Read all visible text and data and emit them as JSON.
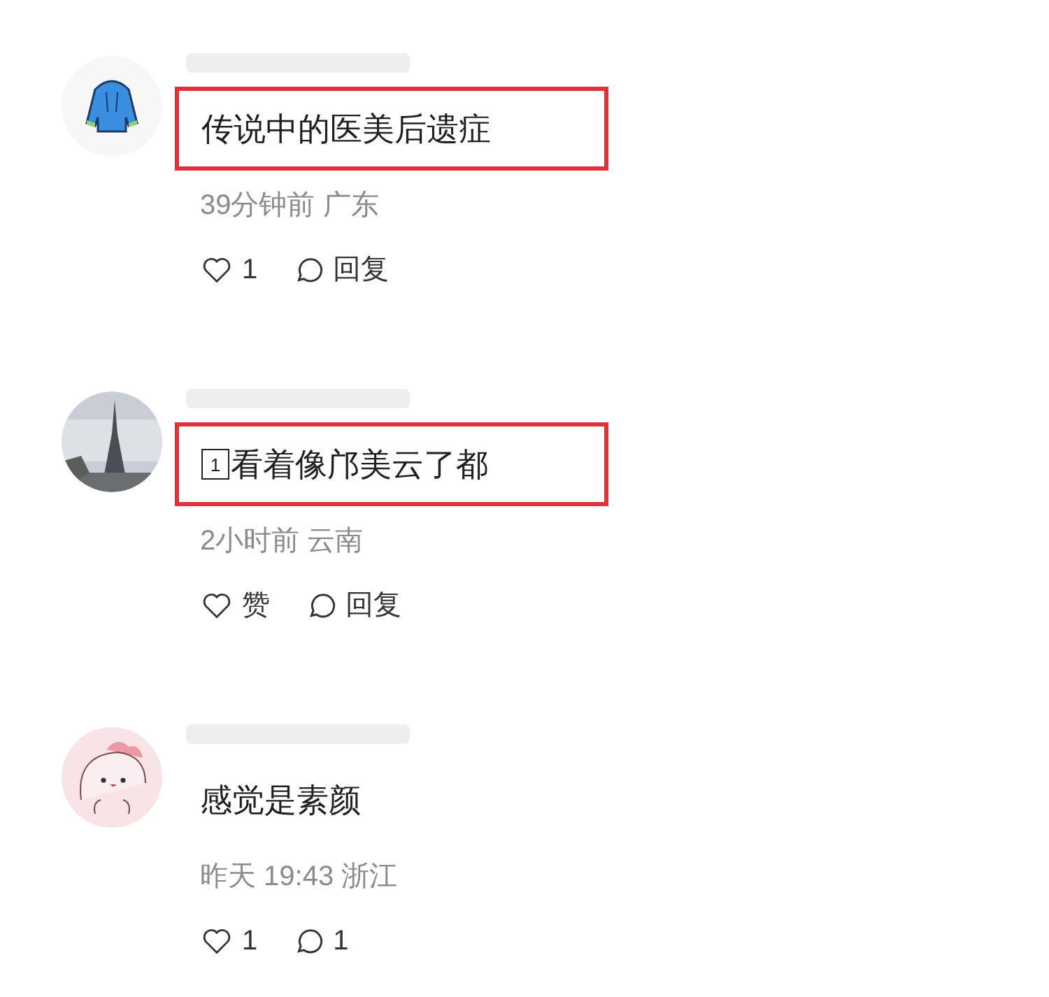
{
  "comments": [
    {
      "avatar": {
        "kind": "hoodie"
      },
      "highlighted": true,
      "text": "传说中的医美后遗症",
      "time": "39分钟前 广东",
      "like": "1",
      "reply": "回复"
    },
    {
      "highlighted": true,
      "badge": "1",
      "text": "看着像邝美云了都",
      "time": "2小时前 云南",
      "like": "赞",
      "reply": "回复"
    },
    {
      "avatar": {
        "kind": "cartoon"
      },
      "highlighted": false,
      "text": "感觉是素颜",
      "time": "昨天 19:43 浙江",
      "like": "1",
      "reply": "1"
    }
  ]
}
